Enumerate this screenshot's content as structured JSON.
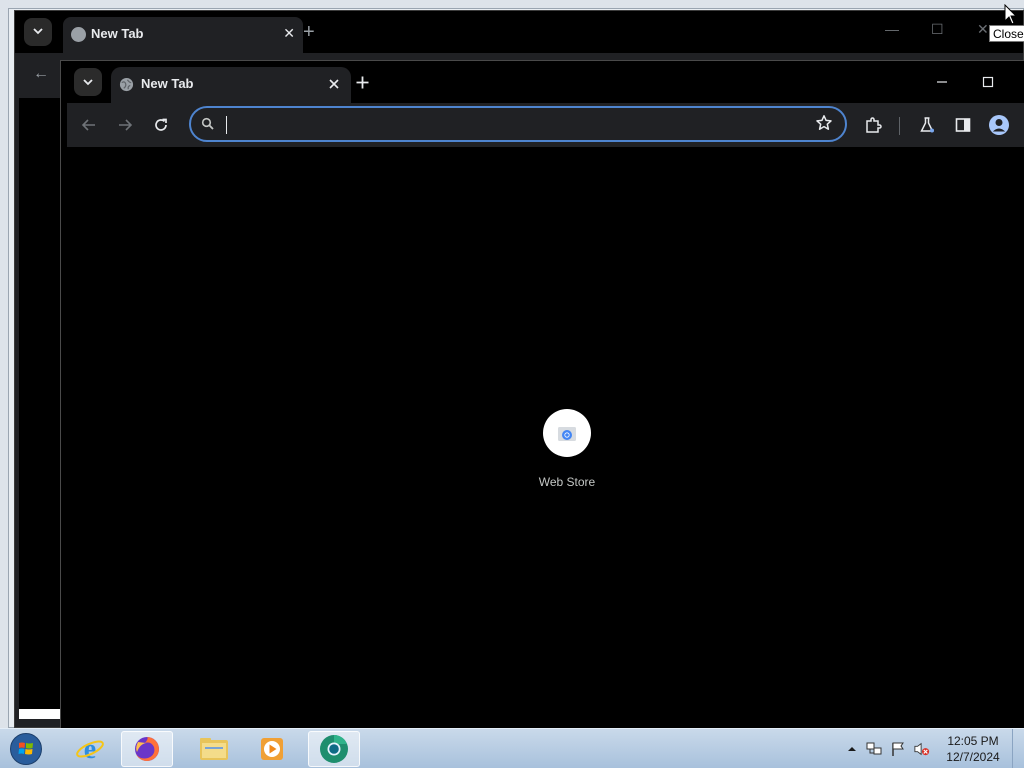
{
  "back_window": {
    "tab_title": "New Tab",
    "close_glyph": "✕",
    "newtab_glyph": "+",
    "back_glyph": "←",
    "min_glyph": "—",
    "max_glyph": "☐"
  },
  "tooltip": {
    "text": "Close"
  },
  "front_window": {
    "tab": {
      "title": "New Tab",
      "favicon": "globe-icon"
    },
    "controls": {
      "minimize": "minimize-icon",
      "maximize": "maximize-icon"
    },
    "omnibox": {
      "value": "",
      "placeholder": ""
    },
    "toolbar_icons": [
      "back-arrow-icon",
      "forward-arrow-icon",
      "reload-icon",
      "bookmark-star-icon",
      "extensions-icon",
      "labs-flask-icon",
      "side-panel-icon",
      "profile-icon"
    ],
    "accent_color": "#4e84cf"
  },
  "content": {
    "shortcuts": [
      {
        "label": "Web Store",
        "icon": "web-store-icon"
      }
    ]
  },
  "taskbar": {
    "items": [
      "start-orb-icon",
      "internet-explorer-icon",
      "firefox-icon",
      "file-explorer-icon",
      "media-player-icon",
      "chrome-icon"
    ],
    "active_item": "firefox-icon",
    "clock": {
      "time": "12:05 PM",
      "date": "12/7/2024"
    }
  }
}
